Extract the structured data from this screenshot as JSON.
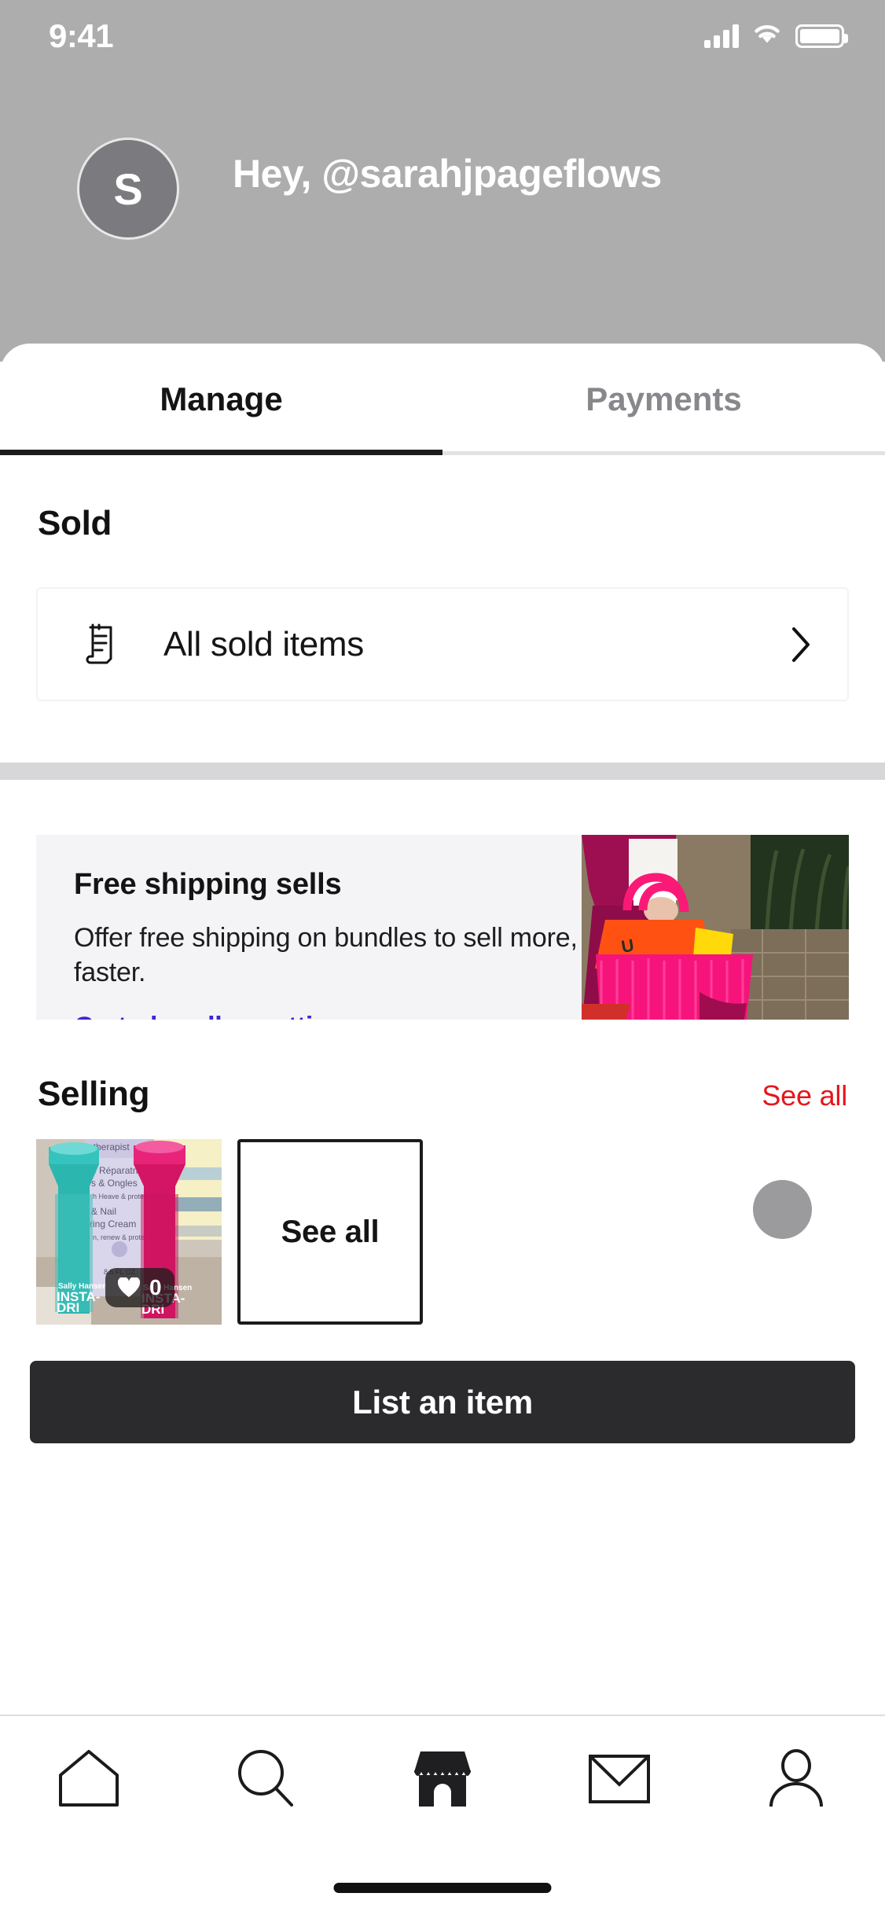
{
  "statusbar": {
    "time": "9:41",
    "moon_icon": "moon-icon",
    "signal_icon": "cellular-signal-icon",
    "wifi_icon": "wifi-icon",
    "battery_icon": "battery-icon"
  },
  "header": {
    "avatar_initial": "S",
    "greeting": "Hey, @sarahjpageflows"
  },
  "tabs": [
    {
      "label": "Manage",
      "active": true
    },
    {
      "label": "Payments",
      "active": false
    }
  ],
  "sold": {
    "section_title": "Sold",
    "row_label": "All sold items",
    "row_icon": "receipt-icon",
    "chevron_icon": "chevron-right-icon"
  },
  "promo": {
    "title": "Free shipping sells",
    "body": "Offer free shipping on bundles to sell more, faster.",
    "link": "Go to bundles setting",
    "link_color": "#3b26d6",
    "background": "#f4f3f6",
    "image_alt": "person-holding-pink-tote-bag"
  },
  "selling": {
    "section_title": "Selling",
    "see_all_link": "See all",
    "see_all_link_color": "#e6161b",
    "see_all_card_label": "See all",
    "product": {
      "alt": "teal-and-pink-nail-polish-bottles",
      "like_count": "0",
      "like_icon": "heart-icon"
    }
  },
  "primary_action": {
    "label": "List an item",
    "background": "#2b2b2d"
  },
  "bottom_nav": [
    {
      "name": "home-icon",
      "label": "Home",
      "active": false
    },
    {
      "name": "search-icon",
      "label": "Search",
      "active": false
    },
    {
      "name": "shop-icon",
      "label": "Shop",
      "active": true
    },
    {
      "name": "mail-icon",
      "label": "Inbox",
      "active": false
    },
    {
      "name": "profile-icon",
      "label": "Profile",
      "active": false
    }
  ]
}
